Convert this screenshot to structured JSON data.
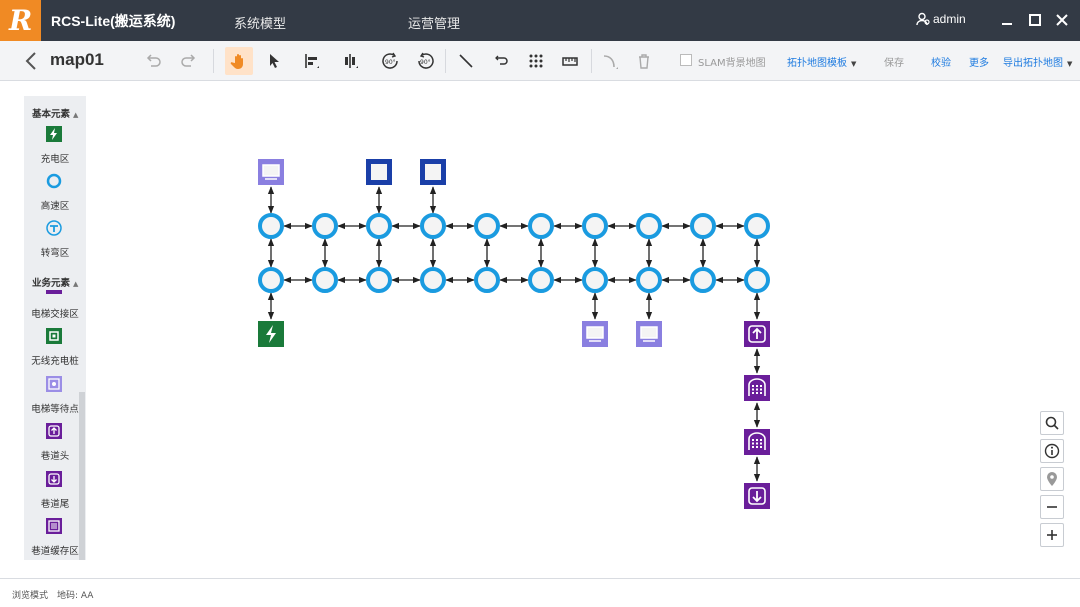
{
  "app": {
    "title": "RCS-Lite(搬运系统)",
    "logo_letter": "R",
    "menu": [
      "系统模型",
      "运营管理"
    ],
    "user": "admin"
  },
  "toolbar": {
    "map_name": "map01",
    "slam_label": "SLAM背景地图",
    "template_label": "拓扑地图模板",
    "save_label": "保存",
    "verify_label": "校验",
    "more_label": "更多",
    "export_label": "导出拓扑地图",
    "rotate_label": "90°"
  },
  "sidebar": {
    "basic_title": "基本元素",
    "basic_items": [
      {
        "label": "充电区",
        "icon": "charge-zone-icon"
      },
      {
        "label": "高速区",
        "icon": "high-speed-zone-icon"
      },
      {
        "label": "转弯区",
        "icon": "turn-zone-icon"
      }
    ],
    "business_title": "业务元素",
    "business_items": [
      {
        "label": "电梯交接区",
        "icon": "elevator-handover-icon"
      },
      {
        "label": "无线充电桩",
        "icon": "wireless-charger-icon"
      },
      {
        "label": "电梯等待点",
        "icon": "elevator-wait-icon"
      },
      {
        "label": "巷道头",
        "icon": "aisle-head-icon"
      },
      {
        "label": "巷道尾",
        "icon": "aisle-tail-icon"
      },
      {
        "label": "巷道缓存区",
        "icon": "aisle-buffer-icon"
      }
    ]
  },
  "map": {
    "grid_cols": 10,
    "grid_rows": 2,
    "colors": {
      "node": "#1a9be0",
      "edge": "#222222",
      "station": "#8a7fe0",
      "blue": "#1a3fa8",
      "charge": "#1a7a3a",
      "aisle": "#6a1e9a"
    }
  },
  "zoom_controls": [
    "search-icon",
    "info-icon",
    "location-icon",
    "zoom-out-icon",
    "zoom-in-icon"
  ],
  "status": {
    "mode": "浏览模式",
    "map_code": "地码: AA"
  }
}
